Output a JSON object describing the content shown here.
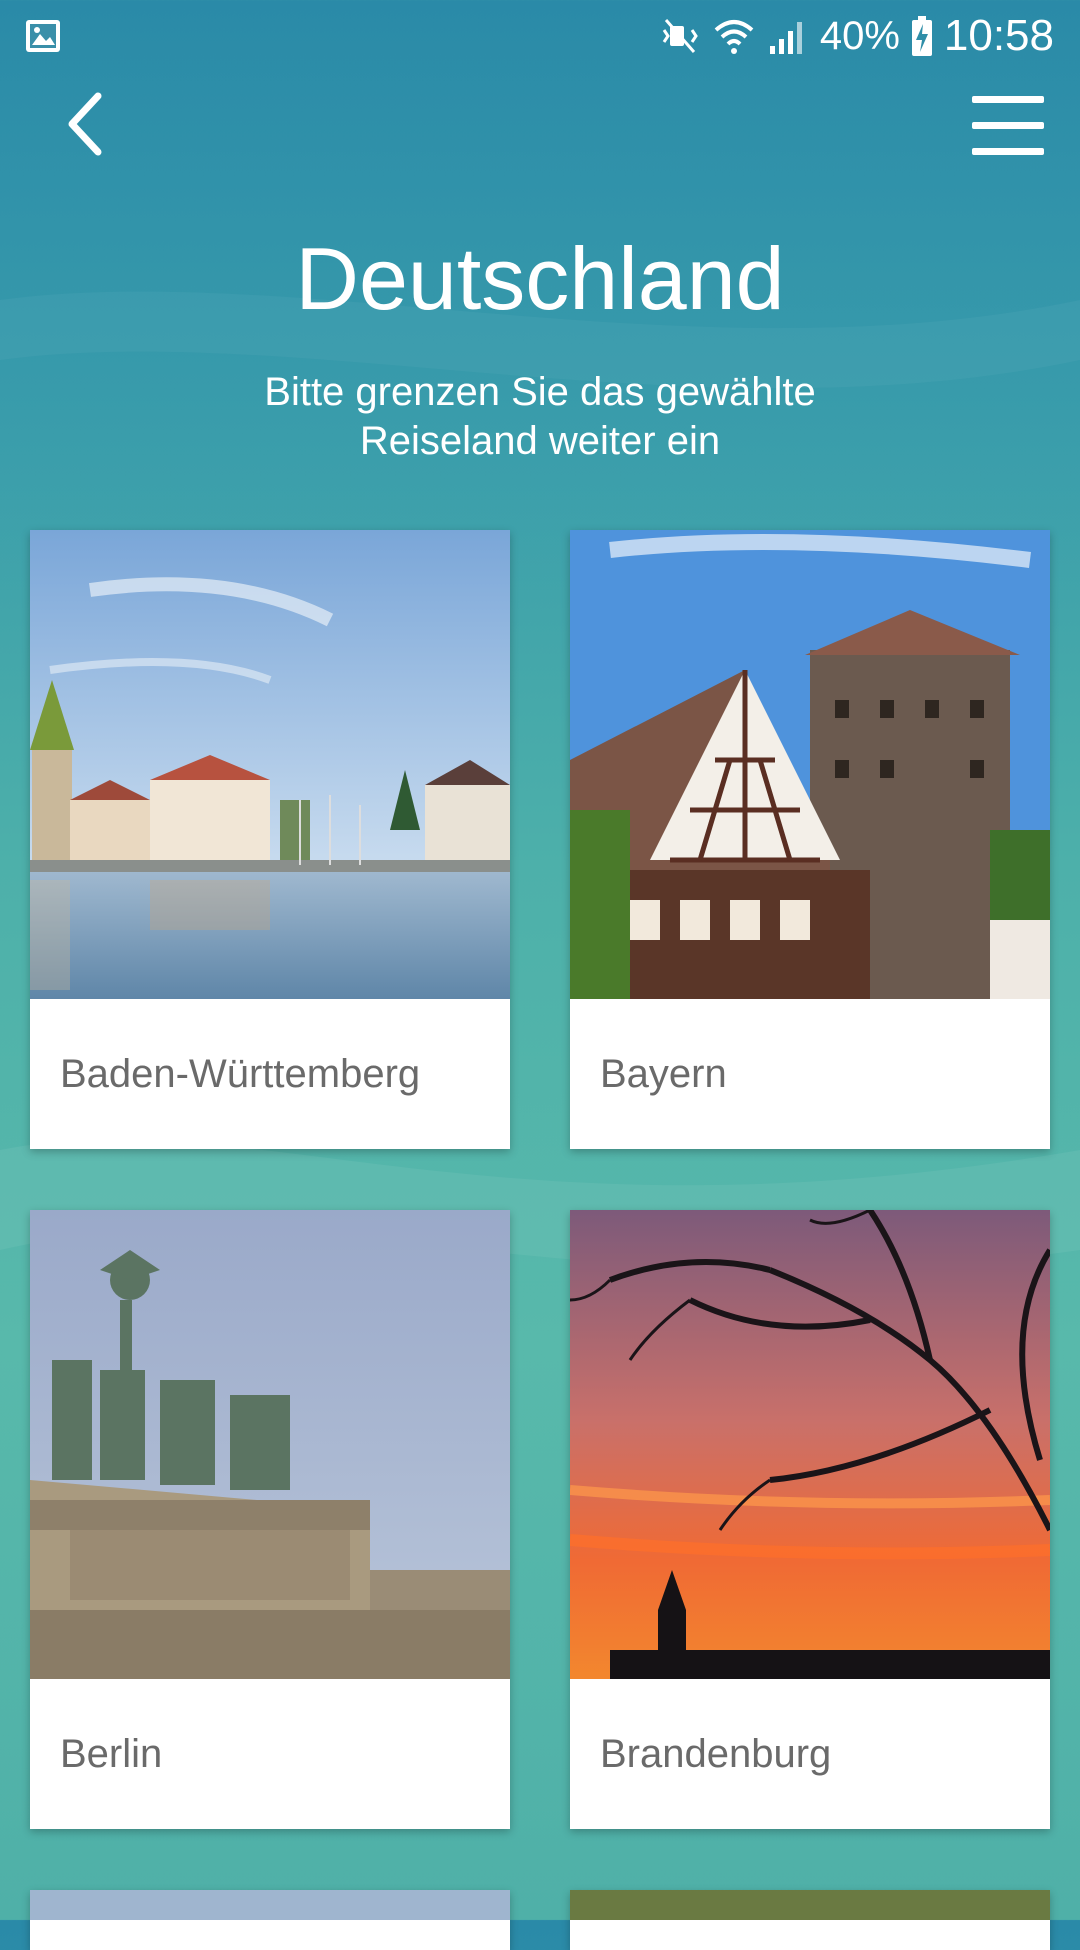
{
  "status_bar": {
    "battery": "40%",
    "time": "10:58",
    "icons": [
      "gallery-icon",
      "mute-icon",
      "wifi-icon",
      "signal-icon",
      "battery-charging-icon"
    ]
  },
  "header": {
    "title": "Deutschland",
    "subtitle_line1": "Bitte grenzen Sie das gewählte",
    "subtitle_line2": "Reiseland weiter ein"
  },
  "regions": [
    {
      "label": "Baden-Württemberg"
    },
    {
      "label": "Bayern"
    },
    {
      "label": "Berlin"
    },
    {
      "label": "Brandenburg"
    }
  ],
  "colors": {
    "accent_text": "#ffffff",
    "card_label": "#6a6a6a",
    "background_top": "#2a8aa8",
    "background_bottom": "#58b9ab"
  }
}
